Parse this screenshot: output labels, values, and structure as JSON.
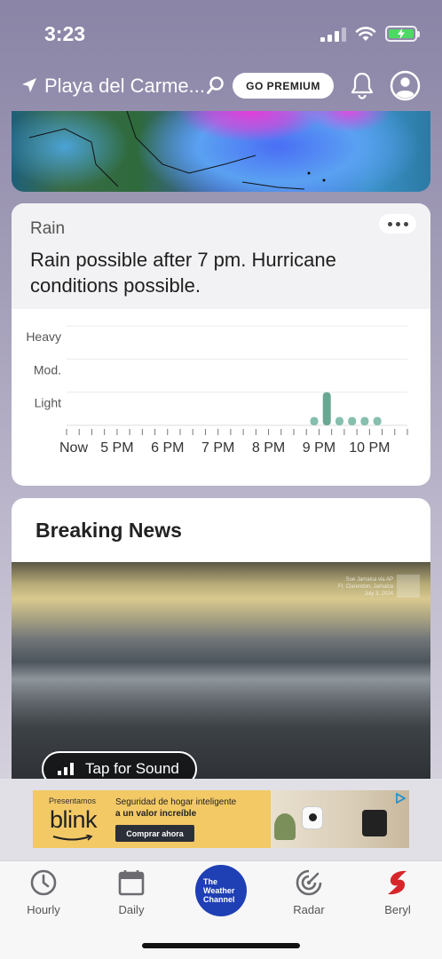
{
  "status_bar": {
    "time": "3:23"
  },
  "header": {
    "location": "Playa del Carme...",
    "premium_label": "GO PREMIUM"
  },
  "rain_card": {
    "title": "Rain",
    "description": "Rain possible after 7 pm. Hurricane conditions possible."
  },
  "chart_data": {
    "type": "bar",
    "y_levels": [
      "Heavy",
      "Mod.",
      "Light"
    ],
    "x_labels": [
      "Now",
      "5 PM",
      "6 PM",
      "7 PM",
      "8 PM",
      "9 PM",
      "10 PM"
    ],
    "ticks_per_hour": 4,
    "values": [
      0,
      0,
      0,
      0,
      0,
      0,
      0,
      0,
      0,
      0,
      0,
      0,
      0,
      0,
      0,
      0,
      0,
      0,
      0.25,
      1.0,
      0.25,
      0.25,
      0.25,
      0.25,
      0,
      0,
      0,
      0
    ],
    "ylim": [
      0,
      3
    ],
    "bar_color": "#86bfae",
    "peak_color": "#6aa793"
  },
  "news_card": {
    "title": "Breaking News",
    "video_credit": [
      "Sue Jamaica via AP",
      "Ft. Clarendon, Jamaica",
      "July 3, 2024"
    ],
    "sound_label": "Tap for Sound"
  },
  "ad": {
    "presentamos": "Presentamos",
    "brand": "blink",
    "line1": "Seguridad de hogar inteligente",
    "line2": "a un valor increíble",
    "cta": "Comprar ahora"
  },
  "tabbar": {
    "hourly": "Hourly",
    "daily": "Daily",
    "logo_text": "The Weather Channel",
    "radar": "Radar",
    "storm": "Beryl"
  },
  "colors": {
    "accent": "#1f3fb5",
    "storm": "#d7262a",
    "rain": "#86bfae"
  }
}
